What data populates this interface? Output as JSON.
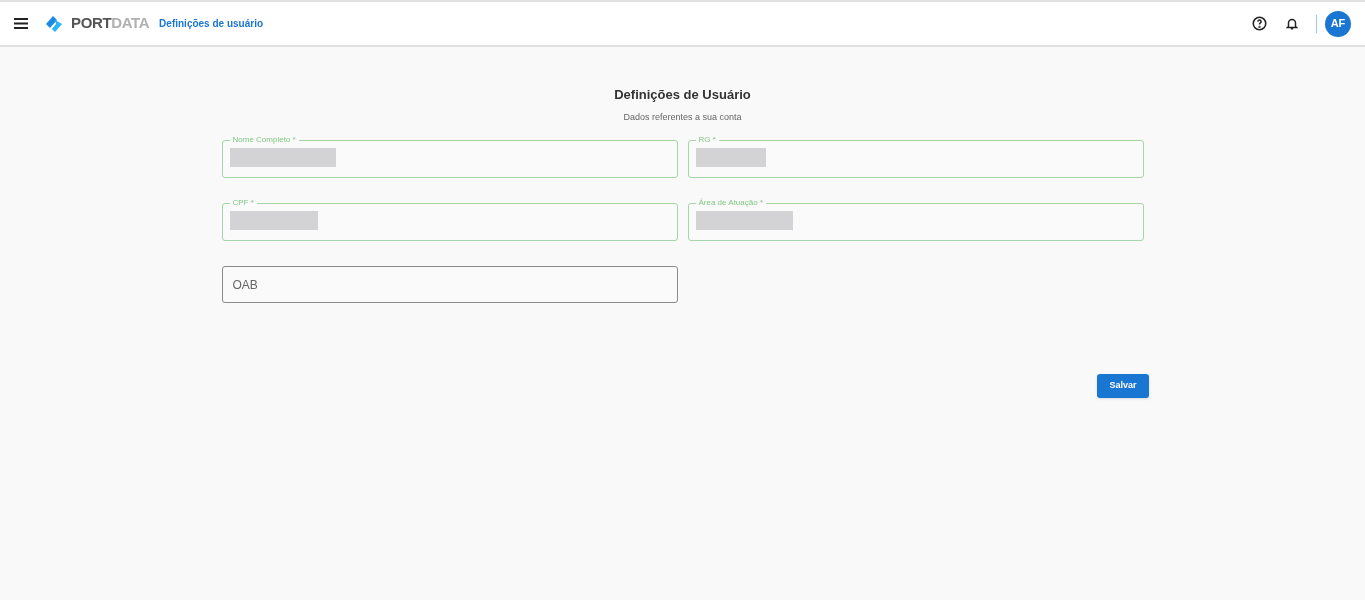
{
  "header": {
    "logo": {
      "primary": "PORT",
      "secondary": "DATA"
    },
    "page_title": "Definições de usuário",
    "avatar": "AF"
  },
  "form": {
    "title": "Definições de Usuário",
    "subtitle": "Dados referentes a sua conta",
    "fields": [
      {
        "kind": "redacted",
        "label": "Nome Completo *"
      },
      {
        "kind": "redacted",
        "label": "RG *"
      },
      {
        "kind": "redacted",
        "label": "CPF *"
      },
      {
        "kind": "redacted",
        "label": "Área de Atuação *"
      },
      {
        "kind": "empty",
        "placeholder": "OAB"
      }
    ],
    "submit": "Salvar"
  }
}
